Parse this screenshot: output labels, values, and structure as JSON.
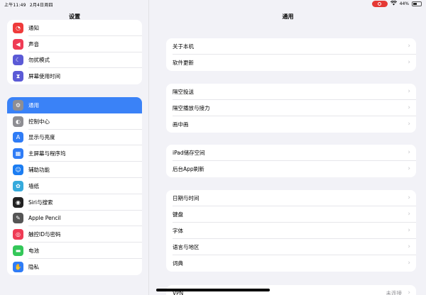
{
  "statusbar": {
    "time": "上午11:49",
    "date": "2月4日周四",
    "battery": "44%",
    "battery_level": 0.44
  },
  "sidebar": {
    "title": "设置",
    "group1": [
      {
        "label": "通知",
        "icon": "bell-icon",
        "color": "#ef3b3b"
      },
      {
        "label": "声音",
        "icon": "speaker-icon",
        "color": "#ef3b55"
      },
      {
        "label": "勿扰模式",
        "icon": "moon-icon",
        "color": "#5b5ad6"
      },
      {
        "label": "屏幕使用时间",
        "icon": "hourglass-icon",
        "color": "#5b5ad6"
      }
    ],
    "group2": [
      {
        "label": "通用",
        "icon": "gear-icon",
        "color": "#8e8e93",
        "selected": true
      },
      {
        "label": "控制中心",
        "icon": "toggles-icon",
        "color": "#8e8e93"
      },
      {
        "label": "显示与亮度",
        "icon": "text-size-icon",
        "color": "#2f7cf6"
      },
      {
        "label": "主屏幕与程序坞",
        "icon": "grid-icon",
        "color": "#2f7cf6"
      },
      {
        "label": "辅助功能",
        "icon": "accessibility-icon",
        "color": "#1c7df2"
      },
      {
        "label": "墙纸",
        "icon": "flower-icon",
        "color": "#35aadc"
      },
      {
        "label": "Siri与搜索",
        "icon": "siri-icon",
        "color": "#222222"
      },
      {
        "label": "Apple Pencil",
        "icon": "pencil-icon",
        "color": "#555555"
      },
      {
        "label": "触控ID与密码",
        "icon": "fingerprint-icon",
        "color": "#ef3b55"
      },
      {
        "label": "电池",
        "icon": "battery-icon",
        "color": "#34c759"
      },
      {
        "label": "隐私",
        "icon": "hand-icon",
        "color": "#2f7cf6"
      }
    ]
  },
  "main": {
    "title": "通用",
    "groups": [
      [
        {
          "label": "关于本机"
        },
        {
          "label": "软件更新"
        }
      ],
      [
        {
          "label": "隔空投送"
        },
        {
          "label": "隔空播放与接力"
        },
        {
          "label": "画中画"
        }
      ],
      [
        {
          "label": "iPad储存空间"
        },
        {
          "label": "后台App刷新"
        }
      ],
      [
        {
          "label": "日期与时间"
        },
        {
          "label": "键盘"
        },
        {
          "label": "字体"
        },
        {
          "label": "语言与地区"
        },
        {
          "label": "词典"
        }
      ],
      [
        {
          "label": "VPN",
          "value": "未连接"
        }
      ]
    ]
  }
}
